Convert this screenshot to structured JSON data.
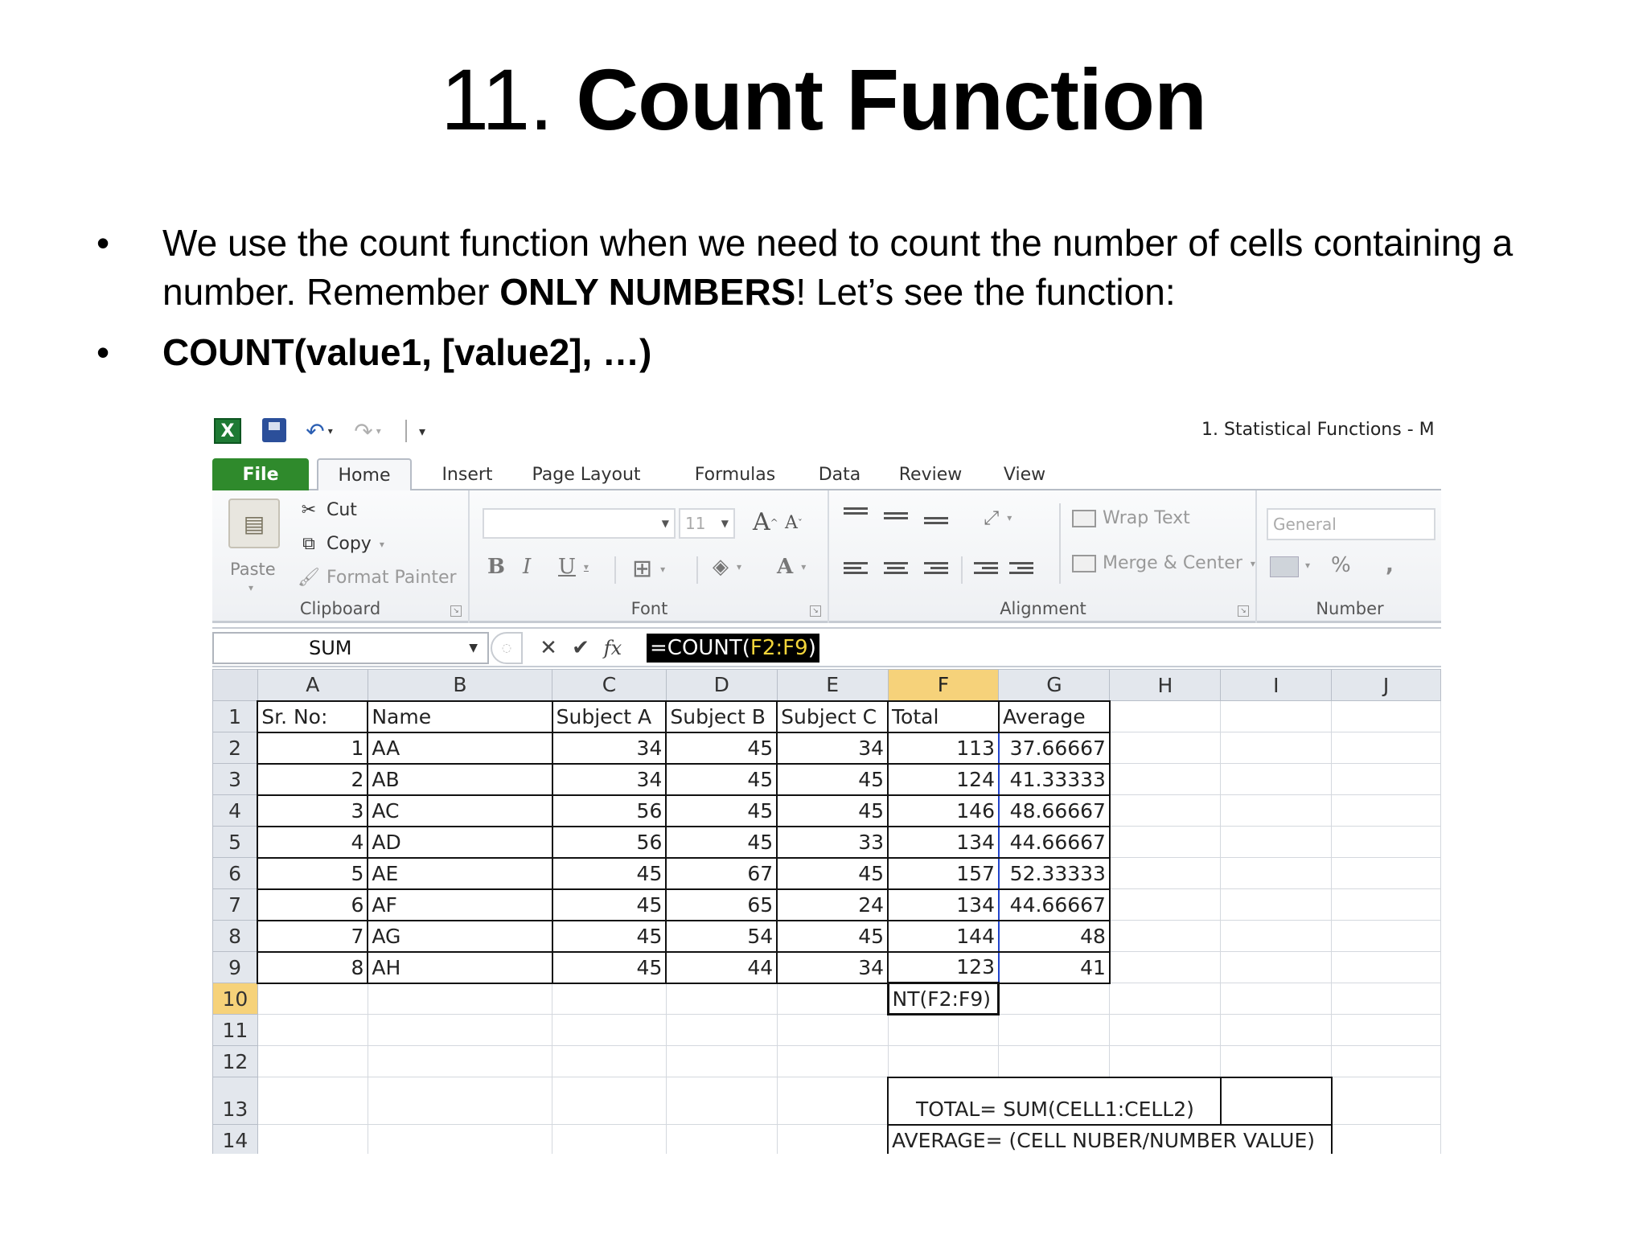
{
  "slide": {
    "title_number": "11.",
    "title_name": "Count Function",
    "bullet1_part1": "We use the count function when we need to count the number of cells containing a number. Remember ",
    "bullet1_bold": "ONLY NUMBERS",
    "bullet1_part2": "! Let’s see the function:",
    "bullet2": "COUNT(value1, [value2], …)",
    "bullet_char": "•"
  },
  "excel": {
    "logo": "X",
    "window_title": "1. Statistical Functions  -  M",
    "tabs": {
      "file": "File",
      "home": "Home",
      "insert": "Insert",
      "page_layout": "Page Layout",
      "formulas": "Formulas",
      "data": "Data",
      "review": "Review",
      "view": "View"
    },
    "ribbon": {
      "clipboard": {
        "label": "Clipboard",
        "paste": "Paste",
        "cut": "Cut",
        "copy": "Copy",
        "format_painter": "Format Painter"
      },
      "font": {
        "label": "Font",
        "font_name": "",
        "font_size": "11"
      },
      "alignment": {
        "label": "Alignment",
        "wrap_text": "Wrap Text",
        "merge_center": "Merge & Center"
      },
      "number": {
        "label": "Number",
        "format": "General"
      }
    },
    "formula_bar": {
      "name_box": "SUM",
      "formula_prefix": "=COUNT(",
      "formula_arg": "F2:F9",
      "formula_suffix": ")"
    },
    "sheet": {
      "columns": [
        "A",
        "B",
        "C",
        "D",
        "E",
        "F",
        "G",
        "H",
        "I",
        "J"
      ],
      "rows": [
        "1",
        "2",
        "3",
        "4",
        "5",
        "6",
        "7",
        "8",
        "9",
        "10",
        "11",
        "12",
        "13",
        "14"
      ],
      "headers": [
        "Sr. No:",
        "Name",
        "Subject A",
        "Subject B",
        "Subject C",
        "Total",
        "Average"
      ],
      "data": [
        [
          "1",
          "AA",
          "34",
          "45",
          "34",
          "113",
          "37.66667"
        ],
        [
          "2",
          "AB",
          "34",
          "45",
          "45",
          "124",
          "41.33333"
        ],
        [
          "3",
          "AC",
          "56",
          "45",
          "45",
          "146",
          "48.66667"
        ],
        [
          "4",
          "AD",
          "56",
          "45",
          "33",
          "134",
          "44.66667"
        ],
        [
          "5",
          "AE",
          "45",
          "67",
          "45",
          "157",
          "52.33333"
        ],
        [
          "6",
          "AF",
          "45",
          "65",
          "24",
          "134",
          "44.66667"
        ],
        [
          "7",
          "AG",
          "45",
          "54",
          "45",
          "144",
          "48"
        ],
        [
          "8",
          "AH",
          "45",
          "44",
          "34",
          "123",
          "41"
        ]
      ],
      "active_cell_text": "NT(F2:F9)",
      "note_total": "TOTAL= SUM(CELL1:CELL2)",
      "note_average": "AVERAGE= (CELL NUBER/NUMBER VALUE)"
    }
  }
}
